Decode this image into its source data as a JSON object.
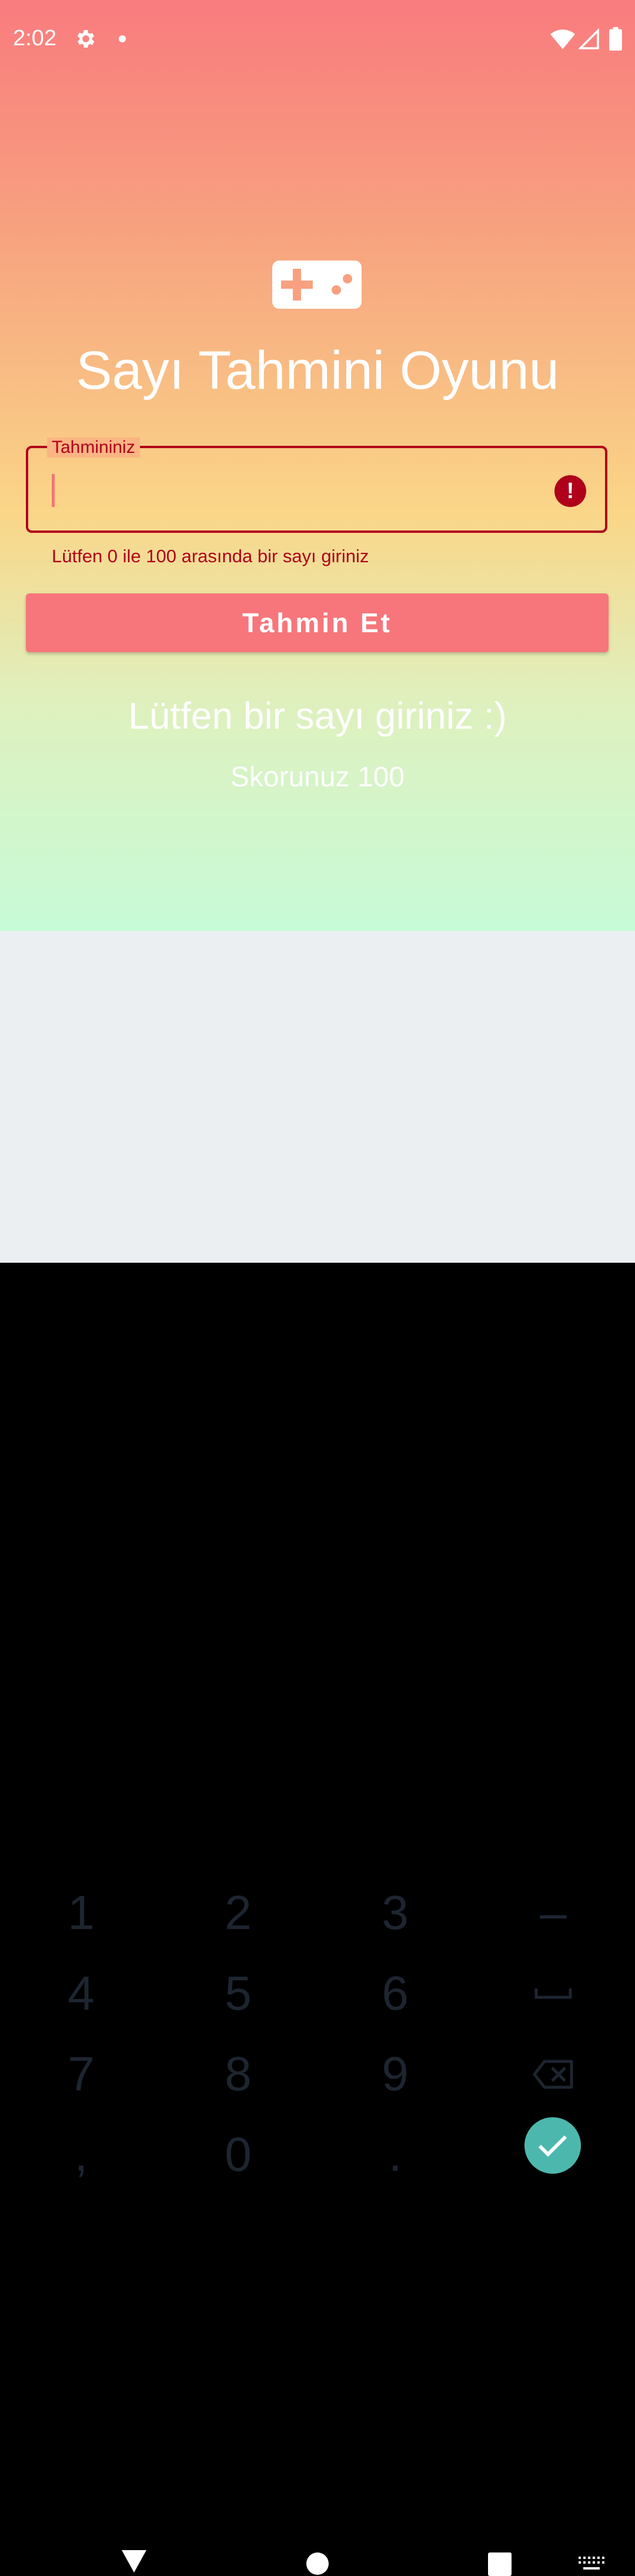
{
  "status_bar": {
    "time": "2:02",
    "icons": [
      "settings-icon",
      "notification-dot-icon",
      "wifi-icon",
      "signal-icon",
      "battery-icon"
    ]
  },
  "app": {
    "logo_icon": "gamepad-icon",
    "title": "Sayı Tahmini Oyunu",
    "guess_field": {
      "label": "Tahmininiz",
      "value": "",
      "error_text": "Lütfen 0 ile 100 arasında bir sayı giriniz",
      "error_icon": "error-icon"
    },
    "submit_button_label": "Tahmin Et",
    "message": "Lütfen bir sayı giriniz :)",
    "score_text": "Skorunuz 100"
  },
  "keyboard": {
    "keys": [
      "1",
      "2",
      "3",
      "–",
      "4",
      "5",
      "6",
      "␣",
      "7",
      "8",
      "9",
      "⌫",
      ",",
      "0",
      ".",
      "✓"
    ],
    "special_icons": [
      "space-icon",
      "backspace-icon",
      "check-icon"
    ]
  },
  "navigation_bar": {
    "icons": [
      "back-icon",
      "home-icon",
      "recents-icon",
      "keyboard-switch-icon"
    ]
  },
  "colors": {
    "gradient_top": "#f97b7e",
    "gradient_mid": "#fad688",
    "gradient_bottom": "#c7fbd8",
    "error": "#b0001a",
    "button": "#f6767c",
    "keyboard_bg": "#eceff1",
    "keyboard_accent": "#4cb8ad"
  }
}
